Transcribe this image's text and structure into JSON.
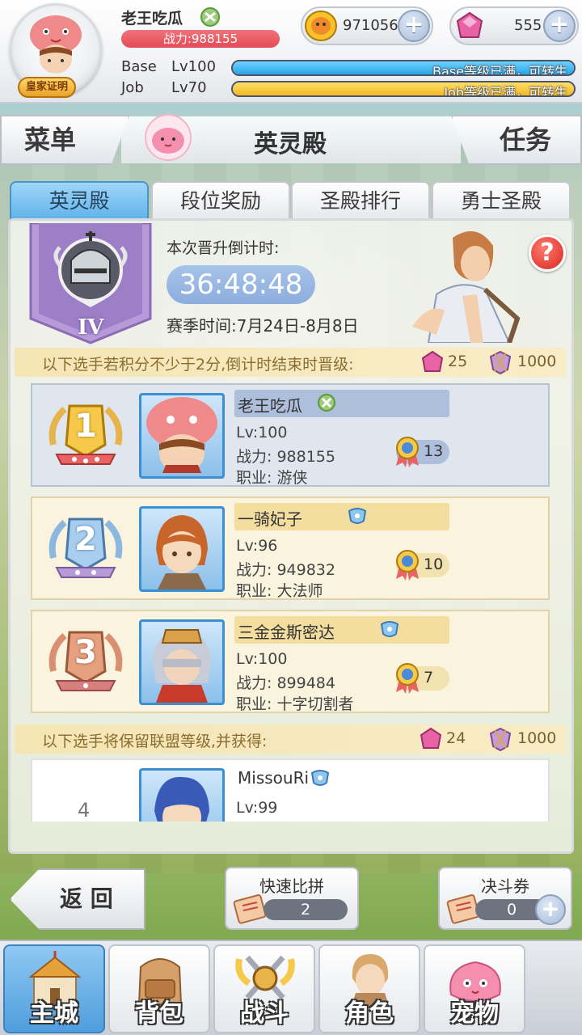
{
  "topbar": {
    "player_name": "老王吃瓜",
    "power": "战力:988155",
    "royal_badge": "皇家证明",
    "coins": "971056",
    "gems": "555",
    "base_label": "Base",
    "base_level": "Lv100",
    "base_status": "Base等级已满，可转生",
    "base_progress": 1.0,
    "job_label": "Job",
    "job_level": "Lv70",
    "job_status": "Job等级已满，可转生",
    "job_progress": 1.0
  },
  "header": {
    "menu": "菜单",
    "title": "英灵殿",
    "task": "任务"
  },
  "tabs": [
    {
      "label": "英灵殿",
      "active": true
    },
    {
      "label": "段位奖励",
      "active": false
    },
    {
      "label": "圣殿排行",
      "active": false
    },
    {
      "label": "勇士圣殿",
      "active": false
    }
  ],
  "season": {
    "rank_roman": "IV",
    "countdown_label": "本次晋升倒计时:",
    "countdown": "36:48:48",
    "season_time": "赛季时间:7月24日-8月8日",
    "help": "?"
  },
  "promote_strip": {
    "text": "以下选手若积分不少于2分,倒计时结束时晋级:",
    "gem_reward": "25",
    "badge_reward": "1000"
  },
  "keep_strip": {
    "text": "以下选手将保留联盟等级,并获得:",
    "gem_reward": "24",
    "badge_reward": "1000"
  },
  "players": [
    {
      "rank": "1",
      "name": "老王吃瓜",
      "level": "Lv:100",
      "power": "战力: 988155",
      "job": "职业: 游侠",
      "score": "13"
    },
    {
      "rank": "2",
      "name": "一骑妃子",
      "level": "Lv:96",
      "power": "战力: 949832",
      "job": "职业: 大法师",
      "score": "10"
    },
    {
      "rank": "3",
      "name": "三金金斯密达",
      "level": "Lv:100",
      "power": "战力: 899484",
      "job": "职业: 十字切割者",
      "score": "7"
    },
    {
      "rank": "4",
      "name": "MissouRi",
      "level": "Lv:99"
    }
  ],
  "actions": {
    "back": "返 回",
    "quick_title": "快速比拼",
    "quick_count": "2",
    "ticket_title": "决斗券",
    "ticket_count": "0"
  },
  "nav": [
    {
      "label": "主城",
      "icon": "castle-icon",
      "active": true
    },
    {
      "label": "背包",
      "icon": "backpack-icon",
      "active": false
    },
    {
      "label": "战斗",
      "icon": "crossed-swords-icon",
      "active": false
    },
    {
      "label": "角色",
      "icon": "character-icon",
      "active": false
    },
    {
      "label": "宠物",
      "icon": "pet-poring-icon",
      "active": false
    }
  ],
  "colors": {
    "accent_blue": "#5fb2ea",
    "power_red": "#e24b56",
    "base_bar": "#2aa4e6",
    "job_bar": "#f3b723",
    "strip_gold": "#f6e4b0"
  }
}
